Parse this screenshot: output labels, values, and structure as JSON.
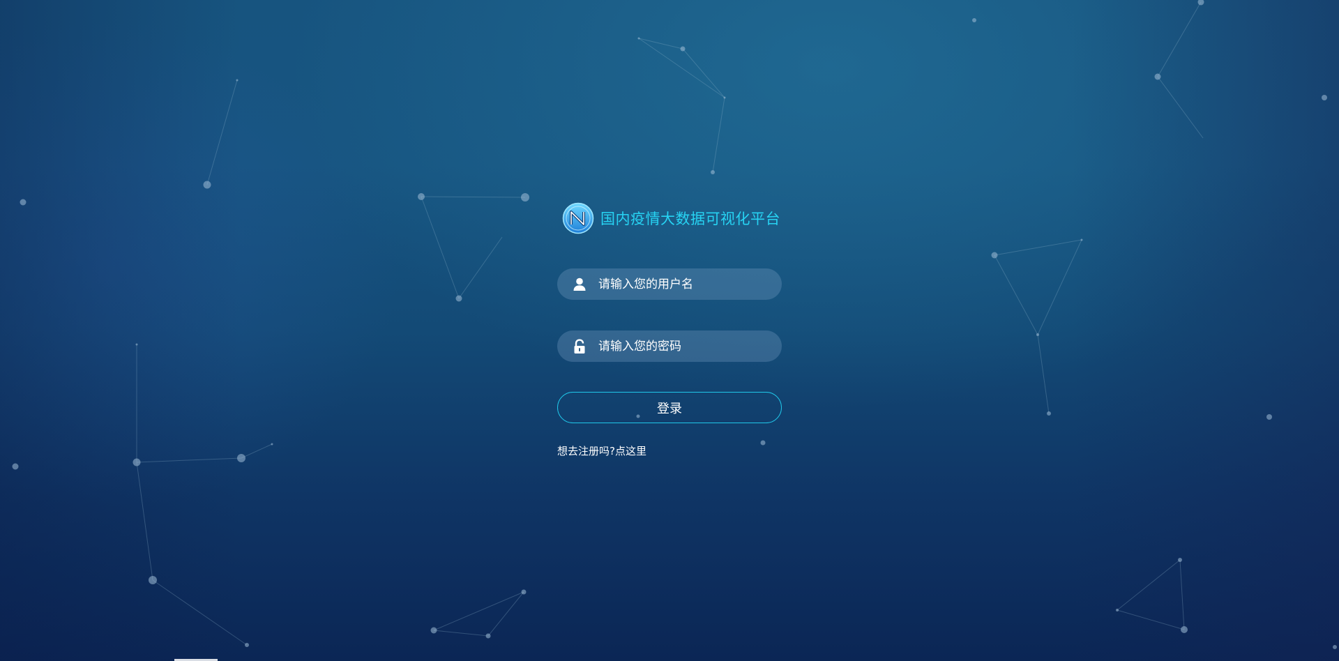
{
  "brand": {
    "title": "国内疫情大数据可视化平台",
    "logo_icon": "circular-n-logo-icon",
    "accent_color": "#27d3f3"
  },
  "login_form": {
    "username": {
      "placeholder": "请输入您的用户名",
      "value": "",
      "icon": "user-icon"
    },
    "password": {
      "placeholder": "请输入您的密码",
      "value": "",
      "icon": "unlocked-padlock-icon"
    },
    "submit_label": "登录",
    "button_border_color": "#20c8ea"
  },
  "register": {
    "prompt": "想去注册吗?",
    "link_text": "点这里"
  },
  "background": {
    "style": "particle network on dark blue gradient",
    "top_color": "#17547f",
    "bottom_color": "#0b2655"
  }
}
